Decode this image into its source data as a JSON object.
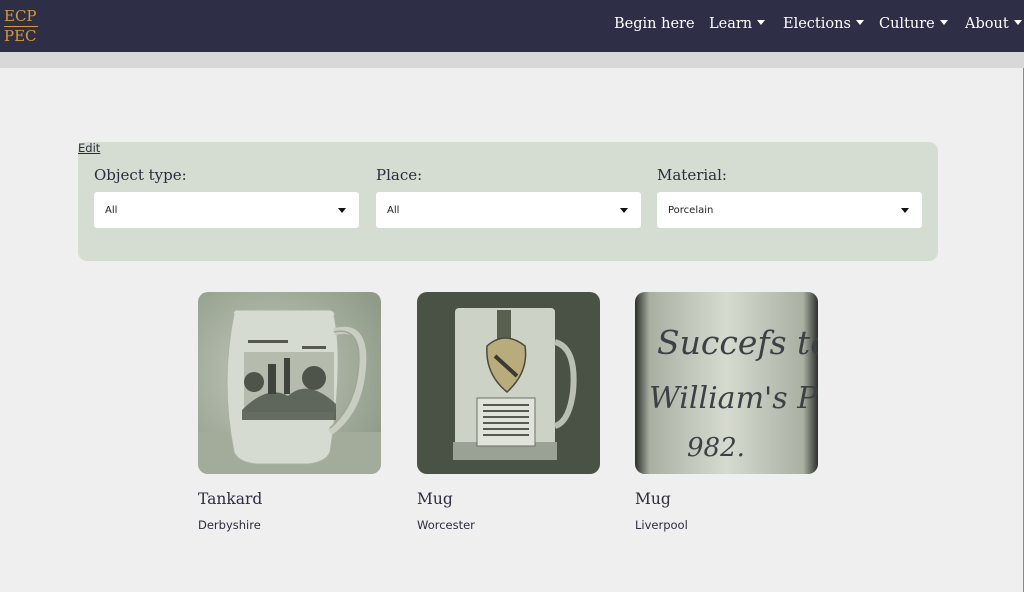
{
  "logo": {
    "line1": "ECP",
    "line2": "PEC"
  },
  "nav": {
    "begin_here": "Begin here",
    "learn": "Learn",
    "elections": "Elections",
    "culture": "Culture",
    "about": "About"
  },
  "edit_link": "Edit",
  "filters": {
    "object_type": {
      "label": "Object type:",
      "value": "All"
    },
    "place": {
      "label": "Place:",
      "value": "All"
    },
    "material": {
      "label": "Material:",
      "value": "Porcelain"
    }
  },
  "cards": [
    {
      "title": "Tankard",
      "place": "Derbyshire"
    },
    {
      "title": "Mug",
      "place": "Worcester"
    },
    {
      "title": "Mug",
      "place": "Liverpool",
      "inscription": [
        "Succefs to",
        "William's Plum",
        "982."
      ]
    }
  ],
  "colors": {
    "navbar": "#2e2e47",
    "logo": "#d69a35",
    "filter_panel": "#d5ddd3",
    "background": "#efefef"
  }
}
